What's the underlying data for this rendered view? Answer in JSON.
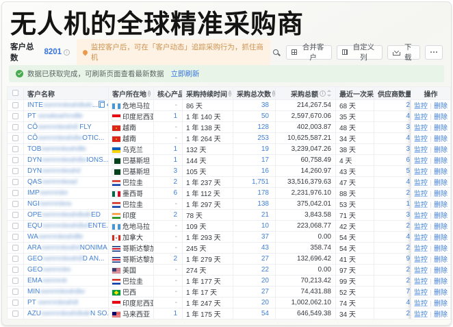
{
  "page": {
    "title": "无人机的全球精准采购商"
  },
  "toolbar": {
    "total_label": "客户总数",
    "total_value": "8201",
    "tip": "监控客户后，可在「客户动态」追踪采购行为，抓住商机",
    "merge_btn": "合并客户",
    "custom_btn": "自定义列",
    "download_btn": "下载"
  },
  "notice": {
    "text": "数据已获取完成，可刷新页面查看最新数据",
    "refresh_link": "立即刷新"
  },
  "headers": {
    "name": "客户名称",
    "loc": "客户所在地",
    "core": "核心产品",
    "dur": "采购持续时间",
    "times": "采购总次数",
    "amt": "采购总额",
    "last": "最近一次采...",
    "sup": "供应商数量",
    "ops": "操作"
  },
  "ops": {
    "monitor": "监控",
    "del": "删除"
  },
  "rows": [
    {
      "name_prefix": "INTE",
      "name_blur": "xwnmrskeahdtwle",
      "name_suffix": "...",
      "flag": "gt",
      "country": "危地马拉",
      "core": "-",
      "duration": "86 天",
      "orders": "38",
      "amount": "214,267.54",
      "last": "68 天",
      "suppliers": "2"
    },
    {
      "name_prefix": "PT ",
      "name_blur": "xsnwkearhmdtle",
      "name_suffix": "",
      "flag": "id",
      "country": "印度尼西亚",
      "core": "1",
      "duration": "1 年 140 天",
      "orders": "50",
      "amount": "2,597,670.06",
      "last": "35 天",
      "suppliers": "4"
    },
    {
      "name_prefix": "CÔ",
      "name_blur": "xwnmrskeahdt",
      "name_suffix": " FLY",
      "flag": "vn",
      "country": "越南",
      "core": "-",
      "duration": "1 年 138 天",
      "orders": "128",
      "amount": "402,003.87",
      "last": "48 天",
      "suppliers": "3"
    },
    {
      "name_prefix": "CÔ",
      "name_blur": "xwnmrskeahdtw",
      "name_suffix": "OTIC...",
      "flag": "vn",
      "country": "越南",
      "core": "-",
      "duration": "1 年 264 天",
      "orders": "253",
      "amount": "10,625,587.21",
      "last": "34 天",
      "suppliers": "4"
    },
    {
      "name_prefix": "TOB",
      "name_blur": "xwnmrskeahdtle",
      "name_suffix": "",
      "flag": "ua",
      "country": "乌克兰",
      "core": "1",
      "duration": "132 天",
      "orders": "19",
      "amount": "3,239,047.26",
      "last": "38 天",
      "suppliers": "3"
    },
    {
      "name_prefix": "DYN",
      "name_blur": "xwnmrskeahdtw",
      "name_suffix": "IONS...",
      "flag": "pk",
      "country": "巴基斯坦",
      "core": "1",
      "duration": "144 天",
      "orders": "17",
      "amount": "60,758.49",
      "last": "4 天",
      "suppliers": "6"
    },
    {
      "name_prefix": "DYN",
      "name_blur": "xwnmrskeahd",
      "name_suffix": "",
      "flag": "pk",
      "country": "巴基斯坦",
      "core": "3",
      "duration": "105 天",
      "orders": "16",
      "amount": "14,260.97",
      "last": "43 天",
      "suppliers": "5"
    },
    {
      "name_prefix": "QAS",
      "name_blur": "xwnmrskead",
      "name_suffix": "",
      "flag": "py",
      "country": "巴拉圭",
      "core": "2",
      "duration": "1 年 237 天",
      "orders": "1,751",
      "amount": "33,516,379.63",
      "last": "47 天",
      "suppliers": "4"
    },
    {
      "name_prefix": "IMP",
      "name_blur": "xwnmrske",
      "name_suffix": "",
      "flag": "mx",
      "country": "墨西哥",
      "core": "6",
      "duration": "1 年 112 天",
      "orders": "178",
      "amount": "2,231,976.10",
      "last": "88 天",
      "suppliers": "2"
    },
    {
      "name_prefix": "NGI",
      "name_blur": "xwnmrskea",
      "name_suffix": "",
      "flag": "py",
      "country": "巴拉圭",
      "core": "-",
      "duration": "1 年 297 天",
      "orders": "138",
      "amount": "375,042.01",
      "last": "53 天",
      "suppliers": "1"
    },
    {
      "name_prefix": "OPE",
      "name_blur": "xwnmrskeahdtwle",
      "name_suffix": "ED",
      "flag": "in",
      "country": "印度",
      "core": "2",
      "duration": "78 天",
      "orders": "21",
      "amount": "3,843.58",
      "last": "71 天",
      "suppliers": "3"
    },
    {
      "name_prefix": "EQU",
      "name_blur": "xwnmrskeahdtwl",
      "name_suffix": "ENTE...",
      "flag": "gt",
      "country": "危地马拉",
      "core": "-",
      "duration": "109 天",
      "orders": "10",
      "amount": "223,068.77",
      "last": "42 天",
      "suppliers": "2"
    },
    {
      "name_prefix": "WA",
      "name_blur": "xwnmrskeahdtle",
      "name_suffix": "",
      "flag": "ca",
      "country": "加拿大",
      "core": "-",
      "duration": "1 年 293 天",
      "orders": "37",
      "amount": "0.00",
      "last": "54 天",
      "suppliers": "4"
    },
    {
      "name_prefix": "ARA",
      "name_blur": "xwnmrskeahd",
      "name_suffix": "NONIMA",
      "flag": "cr",
      "country": "哥斯达黎加",
      "core": "-",
      "duration": "245 天",
      "orders": "43",
      "amount": "358.74",
      "last": "54 天",
      "suppliers": "2"
    },
    {
      "name_prefix": "GEO",
      "name_blur": "xwnmrskeahdt",
      "name_suffix": "D AN...",
      "flag": "cr",
      "country": "哥斯达黎加",
      "core": "2",
      "duration": "1 年 279 天",
      "orders": "27",
      "amount": "132,696.42",
      "last": "41 天",
      "suppliers": "9"
    },
    {
      "name_prefix": "GEO",
      "name_blur": "xwnmrske",
      "name_suffix": "",
      "flag": "us",
      "country": "美国",
      "core": "-",
      "duration": "274 天",
      "orders": "22",
      "amount": "0.00",
      "last": "97 天",
      "suppliers": "2"
    },
    {
      "name_prefix": "EMA",
      "name_blur": "xwnmrsk",
      "name_suffix": "",
      "flag": "py",
      "country": "巴拉圭",
      "core": "-",
      "duration": "1 年 177 天",
      "orders": "20",
      "amount": "70,213.42",
      "last": "99 天",
      "suppliers": "2"
    },
    {
      "name_prefix": "MIN",
      "name_blur": "xwnmrskeahdtw",
      "name_suffix": "",
      "flag": "br",
      "country": "巴西",
      "core": "-",
      "duration": "1 年 17 天",
      "orders": "27",
      "amount": "74,431.88",
      "last": "52 天",
      "suppliers": "7"
    },
    {
      "name_prefix": "PT ",
      "name_blur": "xwnmrskeahdt",
      "name_suffix": "",
      "flag": "id",
      "country": "印度尼西亚",
      "core": "-",
      "duration": "1 年 247 天",
      "orders": "20",
      "amount": "1,002,062.10",
      "last": "74 天",
      "suppliers": "4"
    },
    {
      "name_prefix": "AZU",
      "name_blur": "xwnmrskeahdtwle",
      "name_suffix": "N SO...",
      "flag": "my",
      "country": "马来西亚",
      "core": "1",
      "duration": "1 年 175 天",
      "orders": "54",
      "amount": "646,549.38",
      "last": "34 天",
      "suppliers": "2"
    }
  ]
}
